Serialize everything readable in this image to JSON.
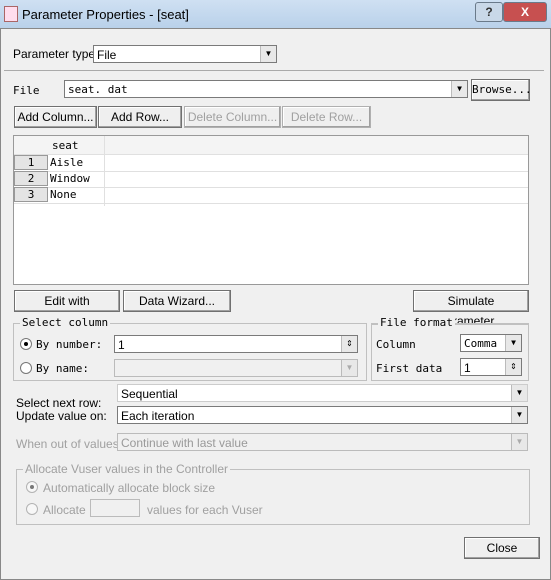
{
  "window": {
    "title": "Parameter Properties - [seat]",
    "help": "?",
    "close": "X"
  },
  "param_type": {
    "label": "Parameter type:",
    "value": "File"
  },
  "file": {
    "label": "File",
    "value": "seat. dat",
    "browse": "Browse..."
  },
  "buttons": {
    "add_column": "Add Column...",
    "add_row": "Add Row...",
    "delete_column": "Delete Column...",
    "delete_row": "Delete Row...",
    "edit_notepad": "Edit with Notepad...",
    "data_wizard": "Data Wizard...",
    "simulate": "Simulate Parameter...",
    "close": "Close"
  },
  "table": {
    "columns": [
      "seat"
    ],
    "rows": [
      {
        "n": "1",
        "seat": "Aisle"
      },
      {
        "n": "2",
        "seat": "Window"
      },
      {
        "n": "3",
        "seat": "None"
      }
    ]
  },
  "select_column": {
    "title": "Select column",
    "by_number": "By number:",
    "by_number_value": "1",
    "by_name": "By name:",
    "selected": "by_number"
  },
  "file_format": {
    "title": "File format",
    "column_label": "Column",
    "column_value": "Comma",
    "first_data_label": "First data",
    "first_data_value": "1"
  },
  "select_next_row": {
    "label": "Select next row:",
    "value": "Sequential"
  },
  "update_value": {
    "label": "Update value on:",
    "value": "Each iteration"
  },
  "out_of_values": {
    "label": "When out of values:",
    "value": "Continue with last value"
  },
  "allocate": {
    "title": "Allocate Vuser values in the Controller",
    "auto": "Automatically allocate block size",
    "allocate": "Allocate",
    "suffix": "values for each Vuser"
  }
}
